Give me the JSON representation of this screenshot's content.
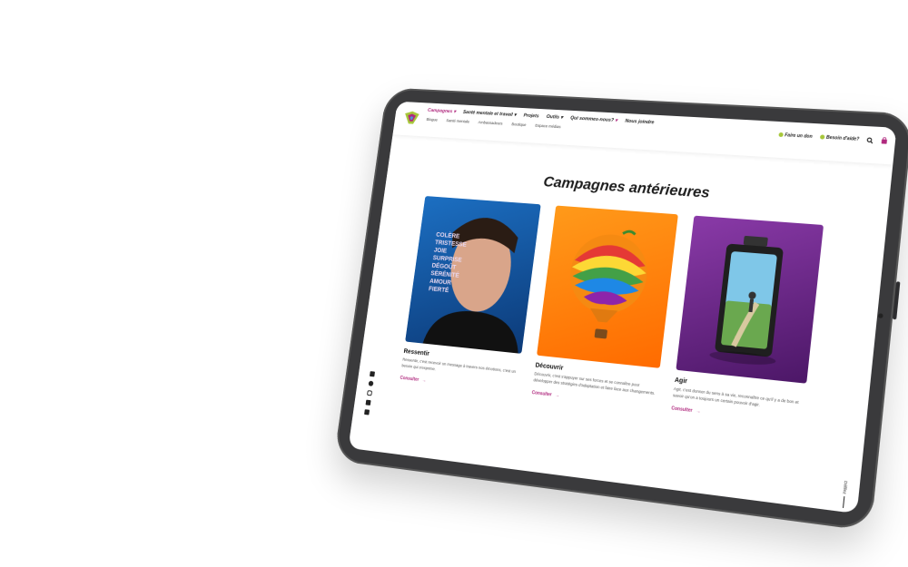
{
  "nav": {
    "primary": [
      {
        "label": "Campagnes",
        "dropdown": true,
        "active": true
      },
      {
        "label": "Santé mentale et travail",
        "dropdown": true
      },
      {
        "label": "Projets",
        "dropdown": false
      },
      {
        "label": "Outils",
        "dropdown": true
      },
      {
        "label": "Qui sommes-nous?",
        "dropdown": true
      },
      {
        "label": "Nous joindre",
        "dropdown": false
      }
    ],
    "secondary": [
      "Blogue",
      "Santé mentale",
      "Ambassadeurs",
      "Boutique",
      "Espace médias"
    ],
    "donate_label": "Faire un don",
    "help_label": "Besoin d'aide?"
  },
  "page": {
    "title": "Campagnes antérieures"
  },
  "cards": [
    {
      "title": "Ressentir",
      "text": "Ressentir, c'est recevoir un message à travers nos émotions, c'est un besoin qui s'exprime.",
      "link": "Consulter"
    },
    {
      "title": "Découvrir",
      "text": "Découvrir, c'est s'appuyer sur ses forces et se connaître pour développer des stratégies d'adaptation et faire face aux changements.",
      "link": "Consulter"
    },
    {
      "title": "Agir",
      "text": "Agir, c'est donner du sens à sa vie, reconnaître ce qu'il y a de bon et savoir qu'on a toujours un certain pouvoir d'agir.",
      "link": "Consulter"
    }
  ],
  "face_words": [
    "COLÈRE",
    "TRISTESSE",
    "JOIE",
    "SURPRISE",
    "DÉGOÛT",
    "SÉRÉNITÉ",
    "AMOUR",
    "FIERTÉ"
  ],
  "scroll_label": "Défilez",
  "colors": {
    "accent": "#b0297e",
    "donate": "#a7c73a",
    "help": "#a7c73a"
  },
  "icons": [
    "youtube-icon",
    "facebook-icon",
    "instagram-icon",
    "twitter-icon",
    "linkedin-icon",
    "search-icon",
    "cart-icon"
  ]
}
